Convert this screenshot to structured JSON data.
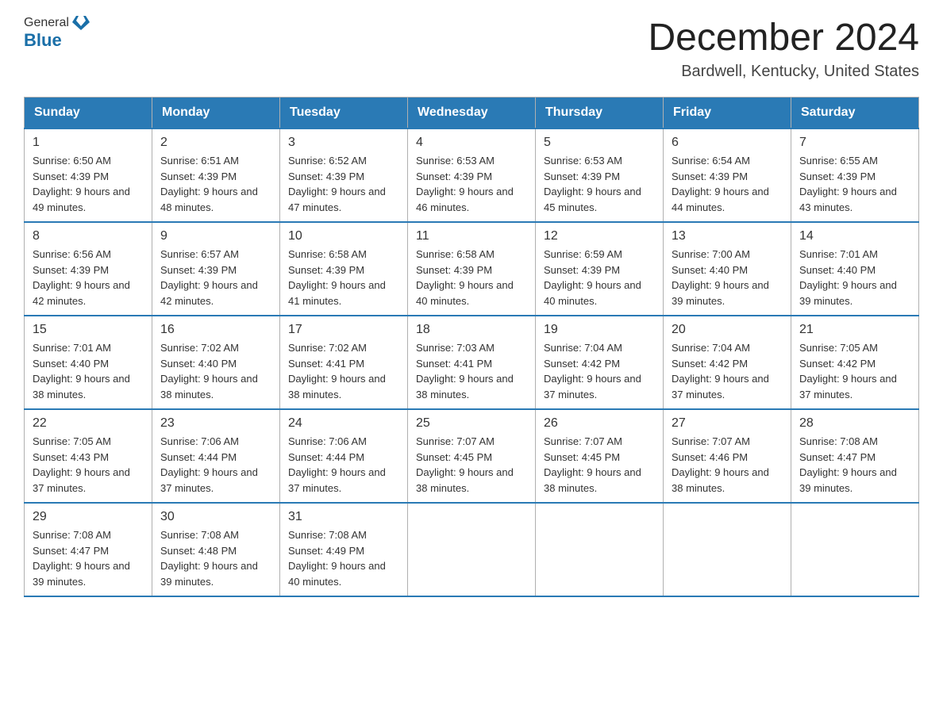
{
  "logo": {
    "general": "General",
    "blue": "Blue"
  },
  "title": "December 2024",
  "location": "Bardwell, Kentucky, United States",
  "days_of_week": [
    "Sunday",
    "Monday",
    "Tuesday",
    "Wednesday",
    "Thursday",
    "Friday",
    "Saturday"
  ],
  "weeks": [
    [
      {
        "day": "1",
        "sunrise": "6:50 AM",
        "sunset": "4:39 PM",
        "daylight": "9 hours and 49 minutes."
      },
      {
        "day": "2",
        "sunrise": "6:51 AM",
        "sunset": "4:39 PM",
        "daylight": "9 hours and 48 minutes."
      },
      {
        "day": "3",
        "sunrise": "6:52 AM",
        "sunset": "4:39 PM",
        "daylight": "9 hours and 47 minutes."
      },
      {
        "day": "4",
        "sunrise": "6:53 AM",
        "sunset": "4:39 PM",
        "daylight": "9 hours and 46 minutes."
      },
      {
        "day": "5",
        "sunrise": "6:53 AM",
        "sunset": "4:39 PM",
        "daylight": "9 hours and 45 minutes."
      },
      {
        "day": "6",
        "sunrise": "6:54 AM",
        "sunset": "4:39 PM",
        "daylight": "9 hours and 44 minutes."
      },
      {
        "day": "7",
        "sunrise": "6:55 AM",
        "sunset": "4:39 PM",
        "daylight": "9 hours and 43 minutes."
      }
    ],
    [
      {
        "day": "8",
        "sunrise": "6:56 AM",
        "sunset": "4:39 PM",
        "daylight": "9 hours and 42 minutes."
      },
      {
        "day": "9",
        "sunrise": "6:57 AM",
        "sunset": "4:39 PM",
        "daylight": "9 hours and 42 minutes."
      },
      {
        "day": "10",
        "sunrise": "6:58 AM",
        "sunset": "4:39 PM",
        "daylight": "9 hours and 41 minutes."
      },
      {
        "day": "11",
        "sunrise": "6:58 AM",
        "sunset": "4:39 PM",
        "daylight": "9 hours and 40 minutes."
      },
      {
        "day": "12",
        "sunrise": "6:59 AM",
        "sunset": "4:39 PM",
        "daylight": "9 hours and 40 minutes."
      },
      {
        "day": "13",
        "sunrise": "7:00 AM",
        "sunset": "4:40 PM",
        "daylight": "9 hours and 39 minutes."
      },
      {
        "day": "14",
        "sunrise": "7:01 AM",
        "sunset": "4:40 PM",
        "daylight": "9 hours and 39 minutes."
      }
    ],
    [
      {
        "day": "15",
        "sunrise": "7:01 AM",
        "sunset": "4:40 PM",
        "daylight": "9 hours and 38 minutes."
      },
      {
        "day": "16",
        "sunrise": "7:02 AM",
        "sunset": "4:40 PM",
        "daylight": "9 hours and 38 minutes."
      },
      {
        "day": "17",
        "sunrise": "7:02 AM",
        "sunset": "4:41 PM",
        "daylight": "9 hours and 38 minutes."
      },
      {
        "day": "18",
        "sunrise": "7:03 AM",
        "sunset": "4:41 PM",
        "daylight": "9 hours and 38 minutes."
      },
      {
        "day": "19",
        "sunrise": "7:04 AM",
        "sunset": "4:42 PM",
        "daylight": "9 hours and 37 minutes."
      },
      {
        "day": "20",
        "sunrise": "7:04 AM",
        "sunset": "4:42 PM",
        "daylight": "9 hours and 37 minutes."
      },
      {
        "day": "21",
        "sunrise": "7:05 AM",
        "sunset": "4:42 PM",
        "daylight": "9 hours and 37 minutes."
      }
    ],
    [
      {
        "day": "22",
        "sunrise": "7:05 AM",
        "sunset": "4:43 PM",
        "daylight": "9 hours and 37 minutes."
      },
      {
        "day": "23",
        "sunrise": "7:06 AM",
        "sunset": "4:44 PM",
        "daylight": "9 hours and 37 minutes."
      },
      {
        "day": "24",
        "sunrise": "7:06 AM",
        "sunset": "4:44 PM",
        "daylight": "9 hours and 37 minutes."
      },
      {
        "day": "25",
        "sunrise": "7:07 AM",
        "sunset": "4:45 PM",
        "daylight": "9 hours and 38 minutes."
      },
      {
        "day": "26",
        "sunrise": "7:07 AM",
        "sunset": "4:45 PM",
        "daylight": "9 hours and 38 minutes."
      },
      {
        "day": "27",
        "sunrise": "7:07 AM",
        "sunset": "4:46 PM",
        "daylight": "9 hours and 38 minutes."
      },
      {
        "day": "28",
        "sunrise": "7:08 AM",
        "sunset": "4:47 PM",
        "daylight": "9 hours and 39 minutes."
      }
    ],
    [
      {
        "day": "29",
        "sunrise": "7:08 AM",
        "sunset": "4:47 PM",
        "daylight": "9 hours and 39 minutes."
      },
      {
        "day": "30",
        "sunrise": "7:08 AM",
        "sunset": "4:48 PM",
        "daylight": "9 hours and 39 minutes."
      },
      {
        "day": "31",
        "sunrise": "7:08 AM",
        "sunset": "4:49 PM",
        "daylight": "9 hours and 40 minutes."
      },
      null,
      null,
      null,
      null
    ]
  ],
  "labels": {
    "sunrise": "Sunrise:",
    "sunset": "Sunset:",
    "daylight": "Daylight:"
  }
}
